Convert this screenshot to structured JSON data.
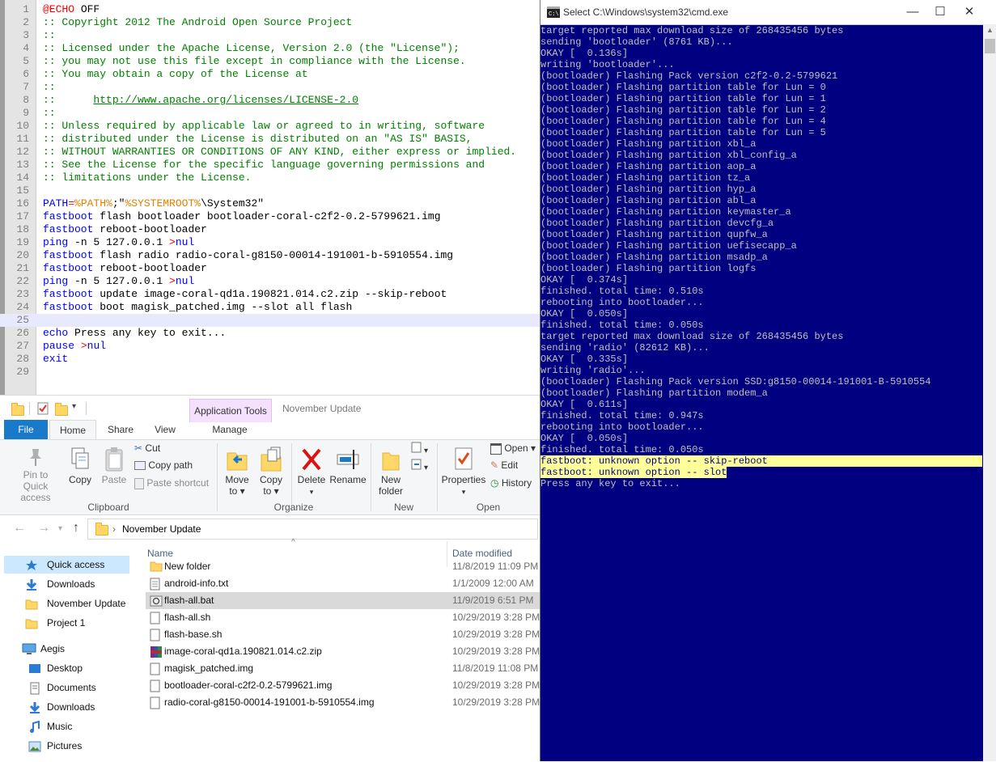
{
  "editor": {
    "lines": [
      {
        "n": "1",
        "segs": [
          {
            "t": "@ECHO",
            "c": "op"
          },
          {
            "t": " OFF",
            "c": ""
          }
        ]
      },
      {
        "n": "2",
        "segs": [
          {
            "t": ":: Copyright 2012 The Android Open Source Project",
            "c": "com"
          }
        ]
      },
      {
        "n": "3",
        "segs": [
          {
            "t": "::",
            "c": "com"
          }
        ]
      },
      {
        "n": "4",
        "segs": [
          {
            "t": ":: Licensed under the Apache License, Version 2.0 (the \"License\");",
            "c": "com"
          }
        ]
      },
      {
        "n": "5",
        "segs": [
          {
            "t": ":: you may not use this file except in compliance with the License.",
            "c": "com"
          }
        ]
      },
      {
        "n": "6",
        "segs": [
          {
            "t": ":: You may obtain a copy of the License at",
            "c": "com"
          }
        ]
      },
      {
        "n": "7",
        "segs": [
          {
            "t": "::",
            "c": "com"
          }
        ]
      },
      {
        "n": "8",
        "segs": [
          {
            "t": "::      ",
            "c": "com"
          },
          {
            "t": "http://www.apache.org/licenses/LICENSE-2.0",
            "c": "link"
          }
        ]
      },
      {
        "n": "9",
        "segs": [
          {
            "t": "::",
            "c": "com"
          }
        ]
      },
      {
        "n": "10",
        "segs": [
          {
            "t": ":: Unless required by applicable law or agreed to in writing, software",
            "c": "com"
          }
        ]
      },
      {
        "n": "11",
        "segs": [
          {
            "t": ":: distributed under the License is distributed on an \"AS IS\" BASIS,",
            "c": "com"
          }
        ]
      },
      {
        "n": "12",
        "segs": [
          {
            "t": ":: WITHOUT WARRANTIES OR CONDITIONS OF ANY KIND, either express or implied.",
            "c": "com"
          }
        ]
      },
      {
        "n": "13",
        "segs": [
          {
            "t": ":: See the License for the specific language governing permissions and",
            "c": "com"
          }
        ]
      },
      {
        "n": "14",
        "segs": [
          {
            "t": ":: limitations under the License.",
            "c": "com"
          }
        ]
      },
      {
        "n": "15",
        "segs": []
      },
      {
        "n": "16",
        "segs": [
          {
            "t": "PATH",
            "c": "kw"
          },
          {
            "t": "=",
            "c": "op"
          },
          {
            "t": "%PATH%",
            "c": "var"
          },
          {
            "t": ";\"",
            "c": ""
          },
          {
            "t": "%SYSTEMROOT%",
            "c": "var"
          },
          {
            "t": "\\System32\"",
            "c": ""
          }
        ]
      },
      {
        "n": "17",
        "segs": [
          {
            "t": "fastboot",
            "c": "kw"
          },
          {
            "t": " flash bootloader bootloader-coral-c2f2-0.2-5799621.img",
            "c": ""
          }
        ]
      },
      {
        "n": "18",
        "segs": [
          {
            "t": "fastboot",
            "c": "kw"
          },
          {
            "t": " reboot-bootloader",
            "c": ""
          }
        ]
      },
      {
        "n": "19",
        "segs": [
          {
            "t": "ping",
            "c": "kw"
          },
          {
            "t": " -n 5 127.0.0.1 ",
            "c": ""
          },
          {
            "t": ">",
            "c": "op"
          },
          {
            "t": "nul",
            "c": "kw"
          }
        ]
      },
      {
        "n": "20",
        "segs": [
          {
            "t": "fastboot",
            "c": "kw"
          },
          {
            "t": " flash radio radio-coral-g8150-00014-191001-b-5910554.img",
            "c": ""
          }
        ]
      },
      {
        "n": "21",
        "segs": [
          {
            "t": "fastboot",
            "c": "kw"
          },
          {
            "t": " reboot-bootloader",
            "c": ""
          }
        ]
      },
      {
        "n": "22",
        "segs": [
          {
            "t": "ping",
            "c": "kw"
          },
          {
            "t": " -n 5 127.0.0.1 ",
            "c": ""
          },
          {
            "t": ">",
            "c": "op"
          },
          {
            "t": "nul",
            "c": "kw"
          }
        ]
      },
      {
        "n": "23",
        "segs": [
          {
            "t": "fastboot",
            "c": "kw"
          },
          {
            "t": " update image-coral-qd1a.190821.014.c2.zip --skip-reboot",
            "c": ""
          }
        ]
      },
      {
        "n": "24",
        "segs": [
          {
            "t": "fastboot",
            "c": "kw"
          },
          {
            "t": " boot magisk_patched.img --slot all flash",
            "c": ""
          }
        ]
      },
      {
        "n": "25",
        "segs": [],
        "current": true
      },
      {
        "n": "26",
        "segs": [
          {
            "t": "echo",
            "c": "kw"
          },
          {
            "t": " Press any key to exit...",
            "c": ""
          }
        ]
      },
      {
        "n": "27",
        "segs": [
          {
            "t": "pause",
            "c": "kw"
          },
          {
            "t": " ",
            "c": ""
          },
          {
            "t": ">",
            "c": "op"
          },
          {
            "t": "nul",
            "c": "kw"
          }
        ]
      },
      {
        "n": "28",
        "segs": [
          {
            "t": "exit",
            "c": "kw"
          }
        ]
      },
      {
        "n": "29",
        "segs": []
      }
    ]
  },
  "explorer": {
    "title": "November Update",
    "context_tab": "Application Tools",
    "tabs": {
      "file": "File",
      "home": "Home",
      "share": "Share",
      "view": "View",
      "manage": "Manage"
    },
    "ribbon": {
      "pin": "Pin to Quick access",
      "copy": "Copy",
      "paste": "Paste",
      "cut": "Cut",
      "copy_path": "Copy path",
      "paste_shortcut": "Paste shortcut",
      "move_to": "Move to ▾",
      "copy_to": "Copy to ▾",
      "delete": "Delete",
      "delete_arrow": "▾",
      "rename": "Rename",
      "new_folder": "New folder",
      "properties": "Properties",
      "properties_arrow": "▾",
      "open": "Open ▾",
      "edit": "Edit",
      "history": "History",
      "groups": {
        "clipboard": "Clipboard",
        "organize": "Organize",
        "new": "New",
        "open": "Open"
      }
    },
    "address": {
      "separator": "›",
      "path": "November Update"
    },
    "nav": [
      {
        "label": "Quick access",
        "icon": "star-icon",
        "selected": true
      },
      {
        "label": "Downloads",
        "icon": "download-icon"
      },
      {
        "label": "November Update",
        "icon": "folder-icon"
      },
      {
        "label": "Project 1",
        "icon": "folder-icon"
      },
      {
        "label": "Aegis",
        "icon": "computer-icon"
      },
      {
        "label": "Desktop",
        "icon": "desktop-icon"
      },
      {
        "label": "Documents",
        "icon": "documents-icon"
      },
      {
        "label": "Downloads",
        "icon": "download-icon"
      },
      {
        "label": "Music",
        "icon": "music-icon"
      },
      {
        "label": "Pictures",
        "icon": "pictures-icon"
      }
    ],
    "columns": {
      "name": "Name",
      "date": "Date modified"
    },
    "files": [
      {
        "name": "New folder",
        "date": "11/8/2019 11:09 PM",
        "icon": "folder-icon"
      },
      {
        "name": "android-info.txt",
        "date": "1/1/2009 12:00 AM",
        "icon": "text-file-icon"
      },
      {
        "name": "flash-all.bat",
        "date": "11/9/2019 6:51 PM",
        "icon": "batch-file-icon",
        "selected": true
      },
      {
        "name": "flash-all.sh",
        "date": "10/29/2019 3:28 PM",
        "icon": "file-icon"
      },
      {
        "name": "flash-base.sh",
        "date": "10/29/2019 3:28 PM",
        "icon": "file-icon"
      },
      {
        "name": "image-coral-qd1a.190821.014.c2.zip",
        "date": "10/29/2019 3:28 PM",
        "icon": "archive-icon"
      },
      {
        "name": "magisk_patched.img",
        "date": "11/8/2019 11:08 PM",
        "icon": "file-icon"
      },
      {
        "name": "bootloader-coral-c2f2-0.2-5799621.img",
        "date": "10/29/2019 3:28 PM",
        "icon": "file-icon"
      },
      {
        "name": "radio-coral-g8150-00014-191001-b-5910554.img",
        "date": "10/29/2019 3:28 PM",
        "icon": "file-icon"
      }
    ]
  },
  "cmd": {
    "title": "Select C:\\Windows\\system32\\cmd.exe",
    "controls": {
      "minimize": "—",
      "maximize": "☐",
      "close": "✕"
    },
    "lines": [
      {
        "t": "target reported max download size of 268435456 bytes"
      },
      {
        "t": "sending 'bootloader' (8761 KB)..."
      },
      {
        "t": "OKAY [  0.136s]"
      },
      {
        "t": "writing 'bootloader'..."
      },
      {
        "t": "(bootloader) Flashing Pack version c2f2-0.2-5799621"
      },
      {
        "t": "(bootloader) Flashing partition table for Lun = 0"
      },
      {
        "t": "(bootloader) Flashing partition table for Lun = 1"
      },
      {
        "t": "(bootloader) Flashing partition table for Lun = 2"
      },
      {
        "t": "(bootloader) Flashing partition table for Lun = 4"
      },
      {
        "t": "(bootloader) Flashing partition table for Lun = 5"
      },
      {
        "t": "(bootloader) Flashing partition xbl_a"
      },
      {
        "t": "(bootloader) Flashing partition xbl_config_a"
      },
      {
        "t": "(bootloader) Flashing partition aop_a"
      },
      {
        "t": "(bootloader) Flashing partition tz_a"
      },
      {
        "t": "(bootloader) Flashing partition hyp_a"
      },
      {
        "t": "(bootloader) Flashing partition abl_a"
      },
      {
        "t": "(bootloader) Flashing partition keymaster_a"
      },
      {
        "t": "(bootloader) Flashing partition devcfg_a"
      },
      {
        "t": "(bootloader) Flashing partition qupfw_a"
      },
      {
        "t": "(bootloader) Flashing partition uefisecapp_a"
      },
      {
        "t": "(bootloader) Flashing partition msadp_a"
      },
      {
        "t": "(bootloader) Flashing partition logfs"
      },
      {
        "t": "OKAY [  0.374s]"
      },
      {
        "t": "finished. total time: 0.510s"
      },
      {
        "t": "rebooting into bootloader..."
      },
      {
        "t": "OKAY [  0.050s]"
      },
      {
        "t": "finished. total time: 0.050s"
      },
      {
        "t": "target reported max download size of 268435456 bytes"
      },
      {
        "t": "sending 'radio' (82612 KB)..."
      },
      {
        "t": "OKAY [  0.335s]"
      },
      {
        "t": "writing 'radio'..."
      },
      {
        "t": "(bootloader) Flashing Pack version SSD:g8150-00014-191001-B-5910554"
      },
      {
        "t": "(bootloader) Flashing partition modem_a"
      },
      {
        "t": "OKAY [  0.611s]"
      },
      {
        "t": "finished. total time: 0.947s"
      },
      {
        "t": "rebooting into bootloader..."
      },
      {
        "t": "OKAY [  0.050s]"
      },
      {
        "t": "finished. total time: 0.050s"
      },
      {
        "t": "fastboot: unknown option -- skip-reboot",
        "hl": true,
        "full": true
      },
      {
        "t": "fastboot: unknown option -- slot",
        "hl": true
      },
      {
        "t": "Press any key to exit..."
      }
    ]
  },
  "colors": {
    "cmd_bg": "#000080",
    "cmd_text": "#c0c0c0",
    "highlight": "#ffff99",
    "accent": "#1979ca",
    "selection": "#cce8ff"
  }
}
